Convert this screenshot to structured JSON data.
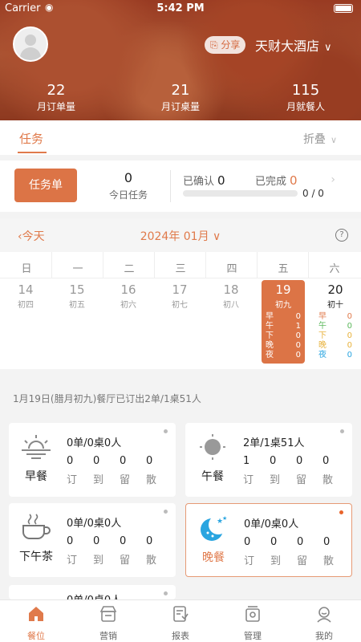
{
  "status_bar": {
    "carrier": "Carrier",
    "time": "5:42 PM"
  },
  "header": {
    "share_label": "分享",
    "hotel_name": "天财大酒店",
    "stats": [
      {
        "value": "22",
        "label": "月订单量"
      },
      {
        "value": "21",
        "label": "月订桌量"
      },
      {
        "value": "115",
        "label": "月就餐人"
      }
    ]
  },
  "task_tabs": {
    "tab": "任务",
    "fold": "折叠"
  },
  "task_card": {
    "button": "任务单",
    "today_count": "0",
    "today_label": "今日任务",
    "confirmed_label": "已确认",
    "confirmed_value": "0",
    "completed_label": "已完成",
    "completed_value": "0",
    "progress_text": "0 / 0",
    "progress": 0
  },
  "calendar": {
    "today_label": "今天",
    "month": "2024年 01月",
    "help": "?",
    "weekdays": [
      "日",
      "一",
      "二",
      "三",
      "四",
      "五",
      "六"
    ],
    "days": [
      {
        "d": "14",
        "lunar": "初四"
      },
      {
        "d": "15",
        "lunar": "初五"
      },
      {
        "d": "16",
        "lunar": "初六"
      },
      {
        "d": "17",
        "lunar": "初七"
      },
      {
        "d": "18",
        "lunar": "初八"
      },
      {
        "d": "19",
        "lunar": "初九"
      },
      {
        "d": "20",
        "lunar": "初十"
      }
    ],
    "selected_meals": [
      {
        "k": "早",
        "v": "0"
      },
      {
        "k": "午",
        "v": "1"
      },
      {
        "k": "下",
        "v": "0"
      },
      {
        "k": "晚",
        "v": "0"
      },
      {
        "k": "夜",
        "v": "0"
      }
    ],
    "sat_meals": [
      {
        "k": "早",
        "v": "0",
        "color": "#e07a4b"
      },
      {
        "k": "午",
        "v": "0",
        "color": "#5cb85c"
      },
      {
        "k": "下",
        "v": "0",
        "color": "#e8b23c"
      },
      {
        "k": "晚",
        "v": "0",
        "color": "#e8b23c"
      },
      {
        "k": "夜",
        "v": "0",
        "color": "#2aa5e0"
      }
    ]
  },
  "summary": "1月19日(腊月初九)餐厅已订出2单/1桌51人",
  "meal_cards": [
    {
      "name": "早餐",
      "summary": "0单/0桌0人",
      "nums": [
        "0",
        "0",
        "0",
        "0"
      ]
    },
    {
      "name": "午餐",
      "summary": "2单/1桌51人",
      "nums": [
        "1",
        "0",
        "0",
        "0"
      ]
    },
    {
      "name": "下午茶",
      "summary": "0单/0桌0人",
      "nums": [
        "0",
        "0",
        "0",
        "0"
      ]
    },
    {
      "name": "晚餐",
      "summary": "0单/0桌0人",
      "nums": [
        "0",
        "0",
        "0",
        "0"
      ]
    },
    {
      "name": "",
      "summary": "0单/0桌0人",
      "nums": []
    }
  ],
  "num_labels": [
    "订",
    "到",
    "留",
    "散"
  ],
  "tabbar": [
    {
      "label": "餐位",
      "icon": "home-icon"
    },
    {
      "label": "营销",
      "icon": "store-icon"
    },
    {
      "label": "报表",
      "icon": "report-icon"
    },
    {
      "label": "管理",
      "icon": "manage-icon"
    },
    {
      "label": "我的",
      "icon": "profile-icon"
    }
  ],
  "colors": {
    "accent": "#dc7446"
  }
}
